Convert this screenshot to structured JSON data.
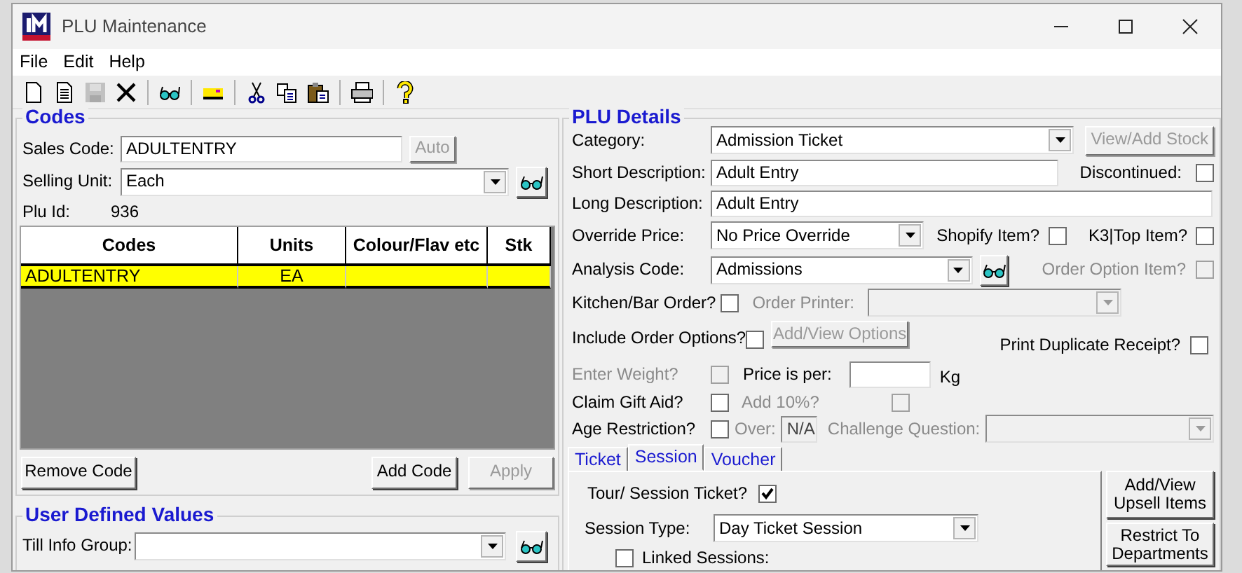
{
  "window": {
    "title": "PLU Maintenance"
  },
  "menu": [
    "File",
    "Edit",
    "Help"
  ],
  "toolbar": [
    {
      "kind": "new",
      "disabled": false
    },
    {
      "kind": "document",
      "disabled": false
    },
    {
      "kind": "save",
      "disabled": true
    },
    {
      "kind": "delete",
      "disabled": false
    },
    {
      "kind": "separator"
    },
    {
      "kind": "find",
      "disabled": false
    },
    {
      "kind": "separator"
    },
    {
      "kind": "card",
      "disabled": false
    },
    {
      "kind": "separator"
    },
    {
      "kind": "cut",
      "disabled": false
    },
    {
      "kind": "copy",
      "disabled": false
    },
    {
      "kind": "paste",
      "disabled": false
    },
    {
      "kind": "separator"
    },
    {
      "kind": "print",
      "disabled": false
    },
    {
      "kind": "separator"
    },
    {
      "kind": "help",
      "disabled": false
    }
  ],
  "codes": {
    "title": "Codes",
    "sales_code": {
      "label": "Sales Code:",
      "value": "ADULTENTRY"
    },
    "auto_button": {
      "label": "Auto",
      "disabled": true
    },
    "selling_unit": {
      "label": "Selling Unit:",
      "value": "Each"
    },
    "plu_id": {
      "label": "Plu Id:",
      "value": "936"
    },
    "table": {
      "columns": [
        "Codes",
        "Units",
        "Colour/Flav etc",
        "Stk"
      ],
      "rows": [
        {
          "cells": [
            "ADULTENTRY",
            "EA",
            "",
            ""
          ],
          "selected": true
        }
      ]
    },
    "buttons": [
      {
        "label": "Remove Code",
        "disabled": false
      },
      {
        "label": "Add Code",
        "disabled": false
      },
      {
        "label": "Apply",
        "disabled": true
      }
    ]
  },
  "user_defined_values": {
    "title": "User Defined Values",
    "till_info_group": {
      "label": "Till Info Group:"
    }
  },
  "plu_details": {
    "title": "PLU Details",
    "category": {
      "label": "Category:",
      "value": "Admission Ticket"
    },
    "view_add_stock": {
      "label": "View/Add Stock",
      "disabled": true
    },
    "short_description": {
      "label": "Short Description:",
      "value": "Adult Entry"
    },
    "discontinued": {
      "label": "Discontinued:",
      "checked": false
    },
    "long_description": {
      "label": "Long Description:",
      "value": "Adult Entry"
    },
    "override_price": {
      "label": "Override Price:",
      "value": "No Price Override"
    },
    "shopify_item": {
      "label": "Shopify Item?",
      "checked": false
    },
    "k3_top_item": {
      "label": "K3|Top Item?",
      "checked": false
    },
    "analysis_code": {
      "label": "Analysis Code:",
      "value": "Admissions"
    },
    "order_option_item": {
      "label": "Order Option Item?",
      "checked": false,
      "disabled": true
    },
    "kitchen_bar_order": {
      "label": "Kitchen/Bar Order?",
      "checked": false
    },
    "order_printer": {
      "label": "Order Printer:",
      "disabled": true
    },
    "include_order_options": {
      "label": "Include Order Options?",
      "checked": false
    },
    "add_view_options": {
      "label": "Add/View Options",
      "disabled": true
    },
    "print_duplicate_receipt": {
      "label": "Print Duplicate Receipt?",
      "checked": false
    },
    "enter_weight": {
      "label": "Enter Weight?",
      "checked": false,
      "disabled": true
    },
    "price_is_per": {
      "label": "Price is per:",
      "unit": "Kg"
    },
    "claim_gift_aid": {
      "label": "Claim Gift Aid?",
      "checked": false
    },
    "add_10_percent": {
      "label": "Add 10%?",
      "checked": false,
      "disabled": true
    },
    "age_restriction": {
      "label": "Age Restriction?",
      "checked": false
    },
    "over": {
      "label": "Over:",
      "value": "N/A",
      "disabled": true
    },
    "challenge_question": {
      "label": "Challenge Question:",
      "disabled": true
    },
    "tabs": [
      {
        "label": "Ticket",
        "selected": false
      },
      {
        "label": "Session",
        "selected": true
      },
      {
        "label": "Voucher",
        "selected": false
      }
    ],
    "session": {
      "tour_session_ticket": {
        "label": "Tour/ Session Ticket?",
        "checked": true
      },
      "session_type": {
        "label": "Session Type:",
        "value": "Day Ticket Session"
      },
      "linked_sessions": {
        "label": "Linked Sessions:",
        "checked": false
      }
    },
    "side_buttons": [
      {
        "label": "Add/View Upsell Items"
      },
      {
        "label": "Restrict To Departments"
      }
    ]
  }
}
